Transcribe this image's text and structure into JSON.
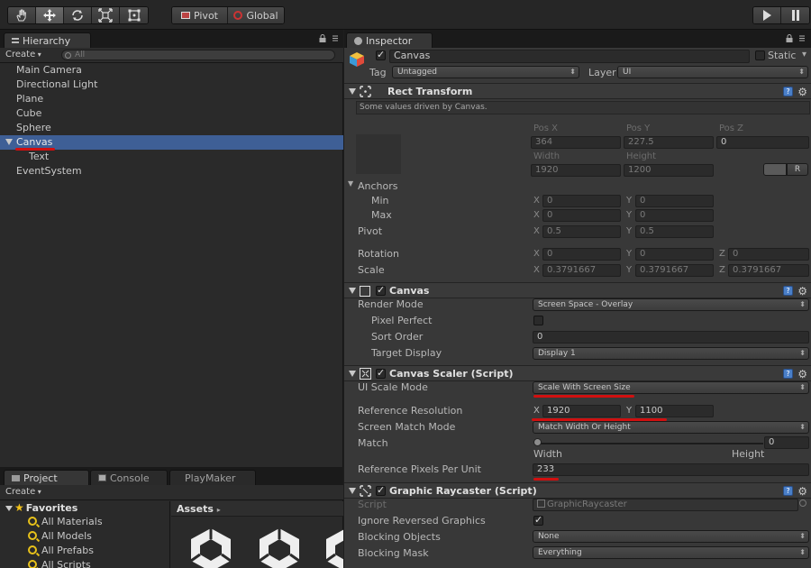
{
  "toolbar": {
    "tools": [
      "hand-icon",
      "move-icon",
      "rotate-icon",
      "scale-icon",
      "rect-icon"
    ],
    "pivot_label": "Pivot",
    "global_label": "Global"
  },
  "hierarchy": {
    "tab": "Hierarchy",
    "create_label": "Create",
    "search_placeholder": "All",
    "items": [
      "Main Camera",
      "Directional Light",
      "Plane",
      "Cube",
      "Sphere",
      "Canvas",
      "Text",
      "EventSystem"
    ]
  },
  "project": {
    "tabs": [
      "Project",
      "Console",
      "PlayMaker"
    ],
    "create_label": "Create",
    "favorites_label": "Favorites",
    "favorites": [
      "All Materials",
      "All Models",
      "All Prefabs",
      "All Scripts"
    ],
    "assets_label": "Assets"
  },
  "inspector": {
    "tab": "Inspector",
    "object_name": "Canvas",
    "static_label": "Static",
    "tag_label": "Tag",
    "tag_value": "Untagged",
    "layer_label": "Layer",
    "layer_value": "UI",
    "rect_transform": {
      "title": "Rect Transform",
      "hint": "Some values driven by Canvas.",
      "pos_x_label": "Pos X",
      "pos_y_label": "Pos Y",
      "pos_z_label": "Pos Z",
      "pos_x": "364",
      "pos_y": "227.5",
      "pos_z": "0",
      "width_label": "Width",
      "height_label": "Height",
      "width": "1920",
      "height": "1200",
      "r_label": "R",
      "anchors_label": "Anchors",
      "min_label": "Min",
      "max_label": "Max",
      "min_x": "0",
      "min_y": "0",
      "max_x": "0",
      "max_y": "0",
      "pivot_label": "Pivot",
      "pivot_x": "0.5",
      "pivot_y": "0.5",
      "rotation_label": "Rotation",
      "rot_x": "0",
      "rot_y": "0",
      "rot_z": "0",
      "scale_label": "Scale",
      "scale_x": "0.3791667",
      "scale_y": "0.3791667",
      "scale_z": "0.3791667",
      "x": "X",
      "y": "Y",
      "z": "Z"
    },
    "canvas": {
      "title": "Canvas",
      "render_mode_label": "Render Mode",
      "render_mode": "Screen Space - Overlay",
      "pixel_perfect_label": "Pixel Perfect",
      "sort_order_label": "Sort Order",
      "sort_order": "0",
      "target_display_label": "Target Display",
      "target_display": "Display 1"
    },
    "canvas_scaler": {
      "title": "Canvas Scaler (Script)",
      "ui_scale_mode_label": "UI Scale Mode",
      "ui_scale_mode": "Scale With Screen Size",
      "ref_res_label": "Reference Resolution",
      "ref_res_x": "1920",
      "ref_res_y": "1100",
      "match_mode_label": "Screen Match Mode",
      "match_mode": "Match Width Or Height",
      "match_label": "Match",
      "match_value": "0",
      "width_label": "Width",
      "height_label": "Height",
      "ppu_label": "Reference Pixels Per Unit",
      "ppu": "233"
    },
    "graphic_raycaster": {
      "title": "Graphic Raycaster (Script)",
      "script_label": "Script",
      "script_value": "GraphicRaycaster",
      "ignore_reversed_label": "Ignore Reversed Graphics",
      "blocking_objects_label": "Blocking Objects",
      "blocking_objects": "None",
      "blocking_mask_label": "Blocking Mask",
      "blocking_mask": "Everything"
    }
  },
  "colors": {
    "selection": "#3e5f96",
    "annotation": "#d01010",
    "help": "#4a7fc8"
  }
}
